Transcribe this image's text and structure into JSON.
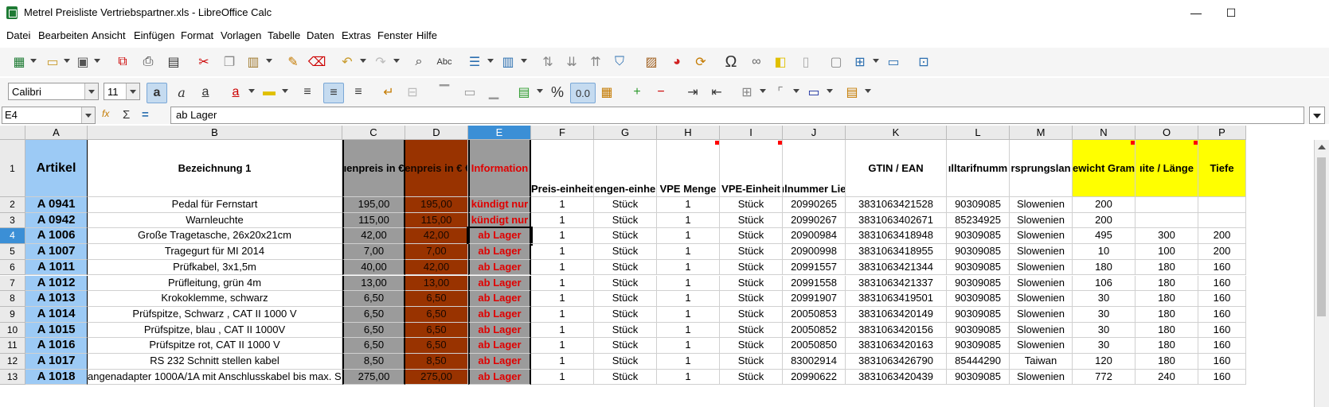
{
  "window": {
    "title": "Metrel Preisliste Vertriebspartner.xls - LibreOffice Calc",
    "min": "—",
    "max": "☐"
  },
  "menu": [
    "Datei",
    "Bearbeiten",
    "Ansicht",
    "Einfügen",
    "Format",
    "Vorlagen",
    "Tabelle",
    "Daten",
    "Extras",
    "Fenster",
    "Hilfe"
  ],
  "format": {
    "font_name": "Calibri",
    "font_size": "11",
    "percent": "%",
    "decimal": "0.0"
  },
  "formula": {
    "cell_ref": "E4",
    "content": "ab Lager",
    "fx": "fx",
    "sigma": "Σ",
    "equals": "="
  },
  "columns": [
    "A",
    "B",
    "C",
    "D",
    "E",
    "F",
    "G",
    "H",
    "I",
    "J",
    "K",
    "L",
    "M",
    "N",
    "O",
    "P"
  ],
  "header": [
    "Artikel",
    "Bezeichnung 1",
    "ıenpreis  in  €",
    "ıenpreis in € €",
    "Information",
    "Preis-einheit",
    "engen-einhe",
    "VPE Menge",
    "VPE-Einheit",
    "ılnummer Lie",
    "GTIN / EAN",
    "ılltarifnumm",
    "rsprungslan",
    "ewicht Gram",
    "ıite / Länge",
    "Tiefe"
  ],
  "rows": [
    {
      "n": "2",
      "c": [
        "A 0941",
        "Pedal für Fernstart",
        "195,00",
        "195,00",
        "kündigt nur",
        "1",
        "Stück",
        "1",
        "Stück",
        "20990265",
        "3831063421528",
        "90309085",
        "Slowenien",
        "200",
        "",
        ""
      ]
    },
    {
      "n": "3",
      "c": [
        "A 0942",
        "Warnleuchte",
        "115,00",
        "115,00",
        "kündigt nur",
        "1",
        "Stück",
        "1",
        "Stück",
        "20990267",
        "3831063402671",
        "85234925",
        "Slowenien",
        "200",
        "",
        ""
      ]
    },
    {
      "n": "4",
      "c": [
        "A 1006",
        "Große Tragetasche,  26x20x21cm",
        "42,00",
        "42,00",
        "ab Lager",
        "1",
        "Stück",
        "1",
        "Stück",
        "20900984",
        "3831063418948",
        "90309085",
        "Slowenien",
        "495",
        "300",
        "200"
      ]
    },
    {
      "n": "5",
      "c": [
        "A 1007",
        "Tragegurt für MI 2014",
        "7,00",
        "7,00",
        "ab Lager",
        "1",
        "Stück",
        "1",
        "Stück",
        "20900998",
        "3831063418955",
        "90309085",
        "Slowenien",
        "10",
        "100",
        "200"
      ]
    },
    {
      "n": "6",
      "c": [
        "A 1011",
        "Prüfkabel, 3x1,5m",
        "40,00",
        "42,00",
        "ab Lager",
        "1",
        "Stück",
        "1",
        "Stück",
        "20991557",
        "3831063421344",
        "90309085",
        "Slowenien",
        "180",
        "180",
        "160"
      ]
    },
    {
      "n": "7",
      "c": [
        "A 1012",
        "Prüfleitung, grün 4m",
        "13,00",
        "13,00",
        "ab Lager",
        "1",
        "Stück",
        "1",
        "Stück",
        "20991558",
        "3831063421337",
        "90309085",
        "Slowenien",
        "106",
        "180",
        "160"
      ]
    },
    {
      "n": "8",
      "c": [
        "A 1013",
        "Krokoklemme, schwarz",
        "6,50",
        "6,50",
        "ab Lager",
        "1",
        "Stück",
        "1",
        "Stück",
        "20991907",
        "3831063419501",
        "90309085",
        "Slowenien",
        "30",
        "180",
        "160"
      ]
    },
    {
      "n": "9",
      "c": [
        "A 1014",
        "Prüfspitze, Schwarz , CAT II 1000 V",
        "6,50",
        "6,50",
        "ab Lager",
        "1",
        "Stück",
        "1",
        "Stück",
        "20050853",
        "3831063420149",
        "90309085",
        "Slowenien",
        "30",
        "180",
        "160"
      ]
    },
    {
      "n": "10",
      "c": [
        "A 1015",
        "Prüfspitze, blau , CAT II 1000V",
        "6,50",
        "6,50",
        "ab Lager",
        "1",
        "Stück",
        "1",
        "Stück",
        "20050852",
        "3831063420156",
        "90309085",
        "Slowenien",
        "30",
        "180",
        "160"
      ]
    },
    {
      "n": "11",
      "c": [
        "A 1016",
        "Prüfspitze rot, CAT II 1000 V",
        "6,50",
        "6,50",
        "ab Lager",
        "1",
        "Stück",
        "1",
        "Stück",
        "20050850",
        "3831063420163",
        "90309085",
        "Slowenien",
        "30",
        "180",
        "160"
      ]
    },
    {
      "n": "12",
      "c": [
        "A 1017",
        "RS 232 Schnitt stellen kabel",
        "8,50",
        "8,50",
        "ab Lager",
        "1",
        "Stück",
        "1",
        "Stück",
        "83002914",
        "3831063426790",
        "85444290",
        "Taiwan",
        "120",
        "180",
        "160"
      ]
    },
    {
      "n": "13",
      "c": [
        "A 1018",
        "angenadapter 1000A/1A mit Anschlusskabel bis max. S",
        "275,00",
        "275,00",
        "ab Lager",
        "1",
        "Stück",
        "1",
        "Stück",
        "20990622",
        "3831063420439",
        "90309085",
        "Slowenien",
        "772",
        "240",
        "160"
      ]
    }
  ],
  "colors": {
    "article_bg": "#9ccaf5",
    "price_grey": "#9b9b9b",
    "price_brown": "#993300",
    "info_red": "#e00000",
    "yellow": "#ffff00",
    "selection": "#3b8fd6"
  },
  "icons": [
    "new-icon",
    "open-icon",
    "save-icon",
    "export-pdf-icon",
    "print-icon",
    "print-preview-icon",
    "cut-icon",
    "copy-icon",
    "paste-icon",
    "clone-formatting-icon",
    "clear-formatting-icon",
    "undo-icon",
    "redo-icon",
    "find-replace-icon",
    "spelling-icon",
    "row-icon",
    "column-icon",
    "sort-icon",
    "sort-ascending-icon",
    "sort-descending-icon",
    "autofilter-icon",
    "insert-image-icon",
    "insert-chart-icon",
    "pivot-table-icon",
    "special-character-icon",
    "hyperlink-icon",
    "comment-icon",
    "headers-footers-icon",
    "define-print-area-icon",
    "freeze-rows-icon",
    "split-window-icon",
    "show-draw-functions-icon"
  ]
}
